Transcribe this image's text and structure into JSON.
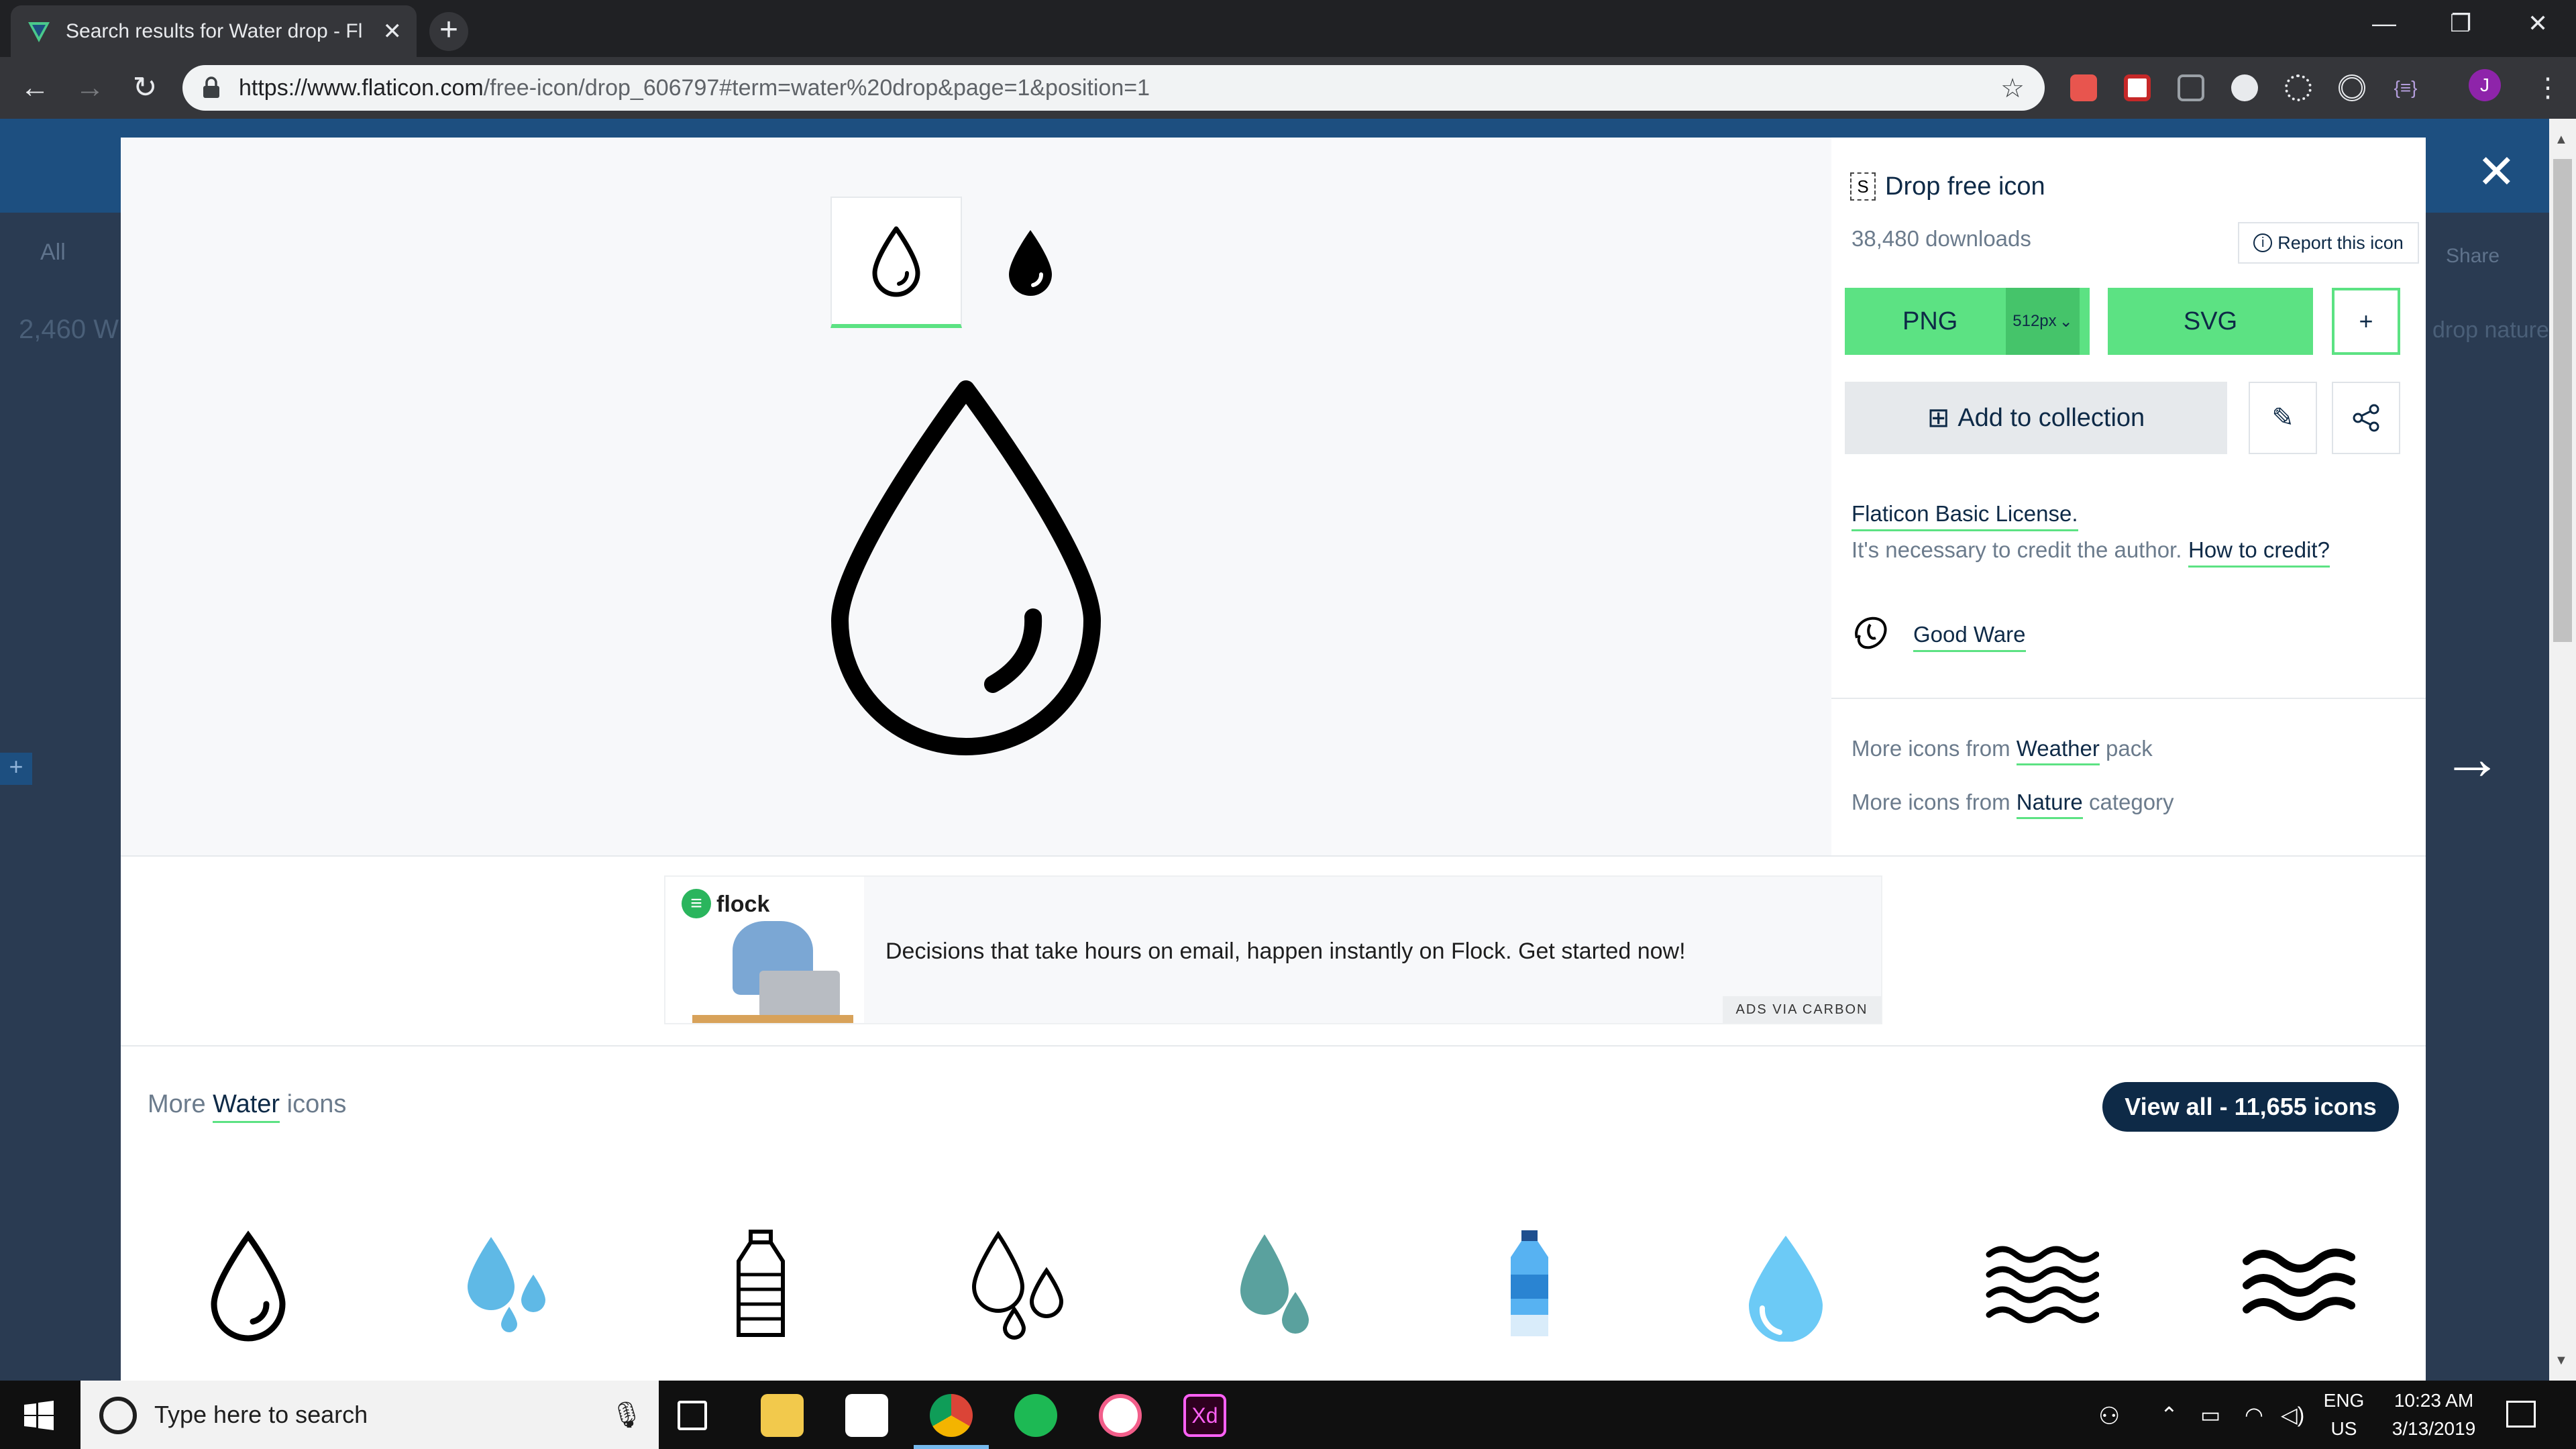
{
  "browser": {
    "tab_title": "Search results for Water drop - Fl",
    "tab_close": "✕",
    "new_tab": "+",
    "url_host": "https://www.flaticon.com",
    "url_path": "/free-icon/drop_606797#term=water%20drop&page=1&position=1",
    "profile_initial": "J",
    "window_controls": [
      "—",
      "❐",
      "✕"
    ]
  },
  "modal": {
    "icon_title": "Drop free icon",
    "downloads": "38,480 downloads",
    "report_label": "Report this icon",
    "png_label": "PNG",
    "png_size": "512px",
    "svg_label": "SVG",
    "plus_label": "+",
    "add_collection_label": "Add to collection",
    "license_title": "Flaticon Basic License.",
    "license_text": "It's necessary to credit the author.",
    "how_to_credit": "How to credit?",
    "author": "Good Ware",
    "more_from_prefix": "More icons from",
    "pack_name": "Weather",
    "pack_suffix": "pack",
    "category_name": "Nature",
    "category_suffix": "category",
    "close": "✕",
    "next": "→"
  },
  "ad": {
    "brand": "flock",
    "text": "Decisions that take hours on email, happen instantly on Flock. Get started now!",
    "label": "ADS VIA CARBON"
  },
  "more_section": {
    "prefix": "More",
    "term": "Water",
    "suffix": "icons",
    "view_all": "View all - 11,655 icons"
  },
  "more_icons": [
    "drop-outline-icon",
    "drops-blue-icon",
    "water-bottle-icon",
    "drops-outline-icon",
    "drops-teal-icon",
    "water-bottle-blue-icon",
    "drop-lightblue-icon",
    "waves-icon",
    "waves-bold-icon"
  ],
  "background_page": {
    "filter_all": "All",
    "results_count": "2,460 W",
    "share": "Share",
    "tag": "drop nature"
  },
  "taskbar": {
    "search_placeholder": "Type here to search",
    "lang_top": "ENG",
    "lang_bottom": "US",
    "time": "10:23 AM",
    "date": "3/13/2019"
  },
  "colors": {
    "accent_green": "#5ce283",
    "dark_navy": "#0e2a47",
    "link_gray": "#6b7b8c"
  }
}
